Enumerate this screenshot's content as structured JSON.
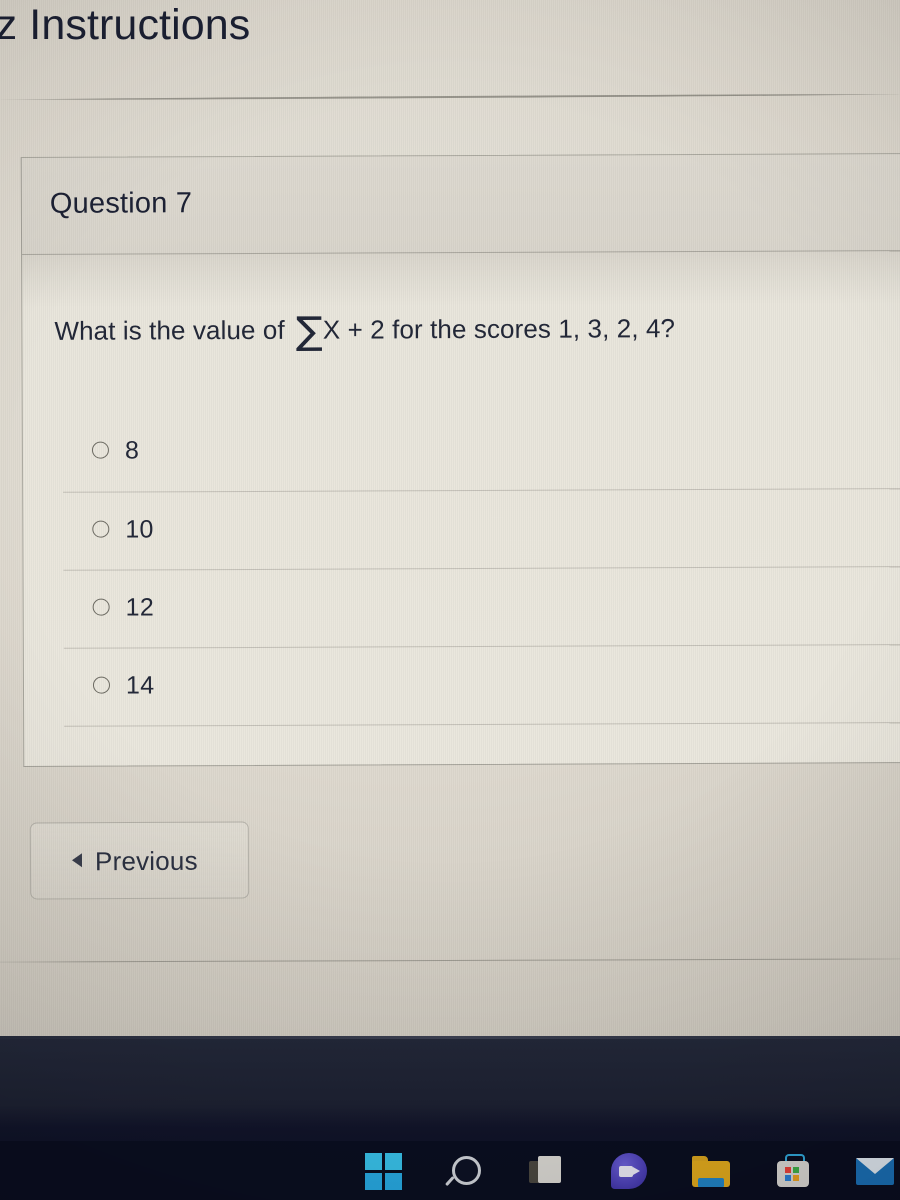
{
  "page": {
    "heading": "iz Instructions",
    "bg_color": "#ded9cf"
  },
  "question_card": {
    "number_label": "Question 7",
    "prompt_prefix": "What is the value of ",
    "sigma_symbol": "∑",
    "prompt_suffix": "X + 2 for the scores 1, 3, 2, 4?",
    "full_prompt": "What is the value of ∑X + 2 for the scores 1, 3, 2, 4?",
    "answers": [
      {
        "label": "8",
        "selected": false
      },
      {
        "label": "10",
        "selected": false
      },
      {
        "label": "12",
        "selected": false
      },
      {
        "label": "14",
        "selected": false
      }
    ]
  },
  "navigation": {
    "previous_label": "Previous",
    "previous_arrow": "◄"
  },
  "taskbar": {
    "icons": [
      {
        "name": "start-icon",
        "label": "Start"
      },
      {
        "name": "search-icon",
        "label": "Search"
      },
      {
        "name": "task-view-icon",
        "label": "Task View"
      },
      {
        "name": "chat-icon",
        "label": "Chat"
      },
      {
        "name": "file-explorer-icon",
        "label": "File Explorer"
      },
      {
        "name": "microsoft-store-icon",
        "label": "Microsoft Store"
      },
      {
        "name": "mail-icon",
        "label": "Mail"
      }
    ],
    "bg_color": "#0a0e20"
  }
}
